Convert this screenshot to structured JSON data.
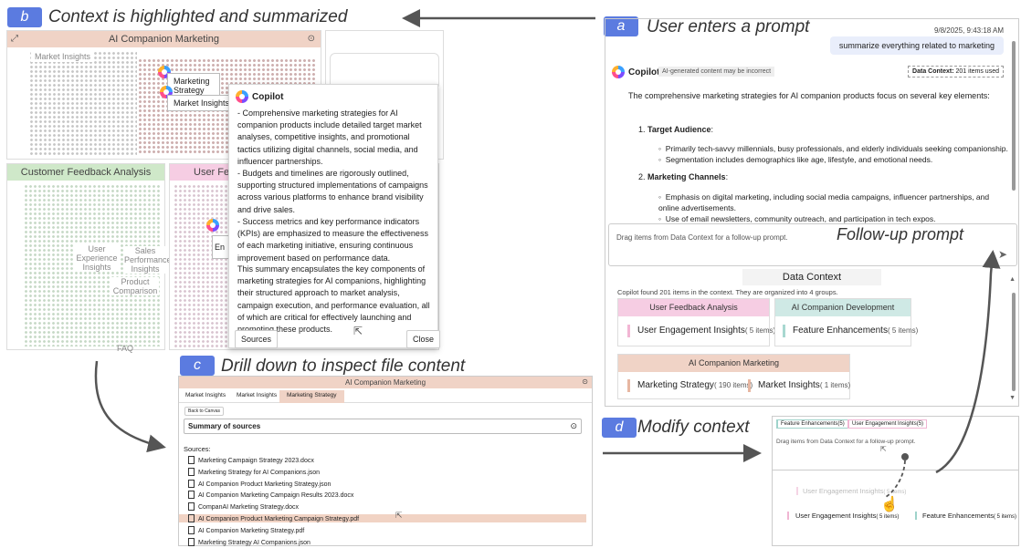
{
  "steps": {
    "a": {
      "letter": "a",
      "title": "User enters a prompt"
    },
    "b": {
      "letter": "b",
      "title": "Context is highlighted and summarized"
    },
    "c": {
      "letter": "c",
      "title": "Drill down to inspect file content"
    },
    "d": {
      "letter": "d",
      "title": "Modify context"
    },
    "followup_label": "Follow-up prompt"
  },
  "canvas": {
    "groups": [
      "AI Companion Marketing",
      "Customer Feedback Analysis",
      "User Fe"
    ],
    "labels": {
      "market_insights": "Market Insights",
      "tag_strategy": "Marketing Strategy",
      "tag_insights": "Market Insights",
      "user_experience": "User Experience Insights",
      "sales": "Sales Performance Insights",
      "product": "Product Comparison",
      "faq": "FAQ",
      "partial": "En"
    }
  },
  "summary_popup": {
    "title": "Copilot",
    "paragraphs": [
      "- Comprehensive marketing strategies for AI companion products include detailed target market analyses, competitive insights, and promotional tactics utilizing digital channels, social media, and influencer partnerships.",
      "- Budgets and timelines are rigorously outlined, supporting structured implementations of campaigns across various platforms to enhance brand visibility and drive sales.",
      "- Success metrics and key performance indicators (KPIs) are emphasized to measure the effectiveness of each marketing initiative, ensuring continuous improvement based on performance data.",
      "This summary encapsulates the key components of marketing strategies for AI companions, highlighting their structured approach to market analysis, campaign execution, and performance evaluation, all of which are critical for effectively launching and promoting these products."
    ],
    "sources_label": "Sources",
    "close_label": "Close"
  },
  "chat": {
    "timestamp": "9/8/2025, 9:43:18 AM",
    "user_message": "summarize everything related to marketing",
    "assistant_name": "Copilot",
    "disclaimer": "AI-generated content may be incorrect",
    "data_context_label": "Data Context:",
    "data_context_value": "201 items used",
    "intro": "The comprehensive marketing strategies for AI companion products focus on several key elements:",
    "sections": [
      {
        "num": "1.",
        "heading": "Target Audience",
        "bullets": [
          "Primarily tech-savvy millennials, busy professionals, and elderly individuals seeking companionship.",
          "Segmentation includes demographics like age, lifestyle, and emotional needs."
        ]
      },
      {
        "num": "2.",
        "heading": "Marketing Channels",
        "bullets": [
          "Emphasis on digital marketing, including social media campaigns, influencer partnerships, and online advertisements.",
          "Use of email newsletters, community outreach, and participation in tech expos."
        ]
      }
    ],
    "input_placeholder": "Drag items from Data Context for a follow-up prompt."
  },
  "data_context": {
    "title": "Data Context",
    "summary": "Copilot found 201 items in the context. They are organized into 4 groups.",
    "groups": [
      {
        "name": "User Feedback Analysis",
        "items": [
          {
            "label": "User Engagement Insights",
            "count": "( 5 items)"
          }
        ]
      },
      {
        "name": "AI Companion Development",
        "items": [
          {
            "label": "Feature Enhancements",
            "count": "( 5 items)"
          }
        ]
      },
      {
        "name": "AI Companion Marketing",
        "items": [
          {
            "label": "Marketing Strategy",
            "count": "( 190 items)"
          },
          {
            "label": "Market Insights",
            "count": "( 1 items)"
          }
        ]
      }
    ]
  },
  "drill": {
    "header": "AI Companion Marketing",
    "tabs": [
      "Market Insights",
      "Market Insights",
      "Marketing Strategy"
    ],
    "back_label": "Back to Canvas",
    "summary_label": "Summary of sources",
    "sources_label": "Sources:",
    "files": [
      "Marketing Campaign Strategy 2023.docx",
      "Marketing Strategy for AI Companions.json",
      "AI Companion Product Marketing Strategy.json",
      "AI Companion Marketing Campaign Results 2023.docx",
      "CompanAI Marketing Strategy.docx",
      "AI Companion Product Marketing Campaign Strategy.pdf",
      "AI Companion Marketing Strategy.pdf",
      "Marketing Strategy AI Companions.json"
    ],
    "highlighted_index": 5
  },
  "modify": {
    "chips": [
      "Feature Enhancements",
      "(5)",
      "User Engagement Insights",
      "(5)"
    ],
    "placeholder": "Drag items from Data Context for a follow-up prompt.",
    "ghost_item": "User Engagement Insights",
    "ghost_count": "( 5 items)",
    "item1": "User Engagement Insights",
    "item1_count": "( 5 items)",
    "item2": "Feature Enhancements",
    "item2_count": "( 5 items)"
  },
  "colors": {
    "badge": "#5b7be0",
    "marketing": "#f0d3c6",
    "feedback_green": "#cfe8c9",
    "feedback_pink": "#f6cde3",
    "development": "#cfe9e5",
    "highlight_row": "#f1d3c4"
  }
}
